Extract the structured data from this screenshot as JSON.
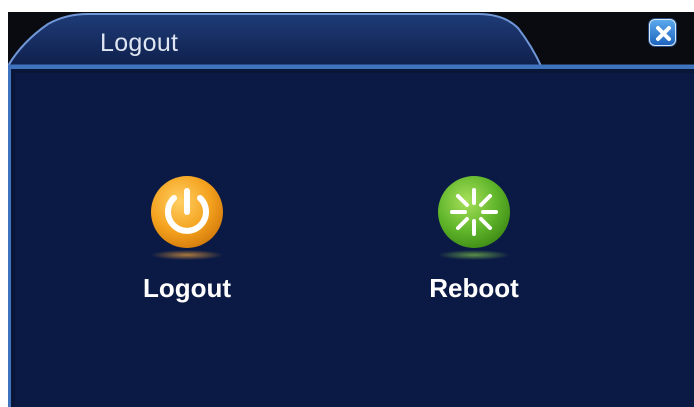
{
  "window": {
    "title": "Logout",
    "close_icon": "close-icon"
  },
  "actions": [
    {
      "label": "Logout",
      "icon": "power-icon",
      "color": "#f4a21e"
    },
    {
      "label": "Reboot",
      "icon": "reboot-icon",
      "color": "#5fb52a"
    }
  ],
  "colors": {
    "panel_bg": "#0b1a44",
    "border": "#3f73bd",
    "titlebar_bg": "#0a0b10"
  }
}
